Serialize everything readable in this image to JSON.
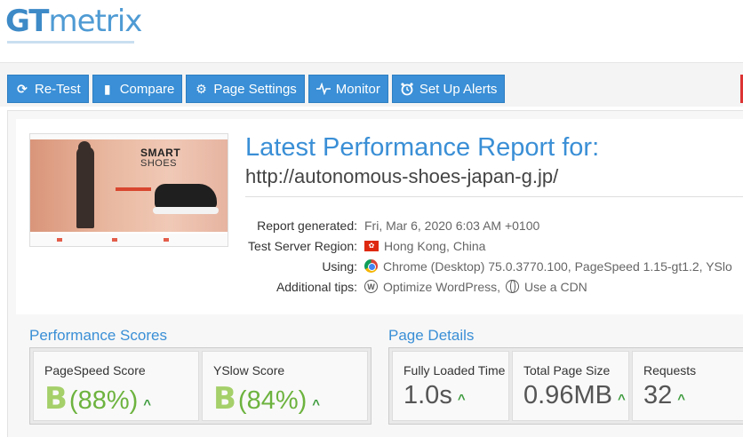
{
  "logo": {
    "part1": "GT",
    "part2": "metrix"
  },
  "toolbar": {
    "buttons": [
      {
        "icon": "refresh-icon",
        "label": "Re-Test"
      },
      {
        "icon": "document-icon",
        "label": "Compare"
      },
      {
        "icon": "gear-icon",
        "label": "Page Settings"
      },
      {
        "icon": "pulse-icon",
        "label": "Monitor"
      },
      {
        "icon": "alarm-clock-icon",
        "label": "Set Up Alerts"
      }
    ]
  },
  "thumbnail": {
    "headline1": "SMART",
    "headline2": "SHOES"
  },
  "report": {
    "title": "Latest Performance Report for:",
    "url": "http://autonomous-shoes-japan-g.jp/",
    "generated_label": "Report generated:",
    "generated_value": "Fri, Mar 6, 2020 6:03 AM +0100",
    "region_label": "Test Server Region:",
    "region_value": "Hong Kong, China",
    "using_label": "Using:",
    "using_value": "Chrome (Desktop) 75.0.3770.100, PageSpeed 1.15-gt1.2, YSlo",
    "tips_label": "Additional tips:",
    "tip1": "Optimize WordPress,",
    "tip2": "Use a CDN"
  },
  "performance": {
    "heading": "Performance Scores",
    "pagespeed_label": "PageSpeed Score",
    "pagespeed_grade": "B",
    "pagespeed_pct": "(88%)",
    "yslow_label": "YSlow Score",
    "yslow_grade": "B",
    "yslow_pct": "(84%)"
  },
  "details": {
    "heading": "Page Details",
    "loaded_label": "Fully Loaded Time",
    "loaded_value": "1.0s",
    "size_label": "Total Page Size",
    "size_value": "0.96MB",
    "requests_label": "Requests",
    "requests_value": "32"
  },
  "colors": {
    "brand_blue": "#3a8fd6",
    "grade_green": "#a5d06a",
    "trend_green": "#3c9a3c"
  }
}
